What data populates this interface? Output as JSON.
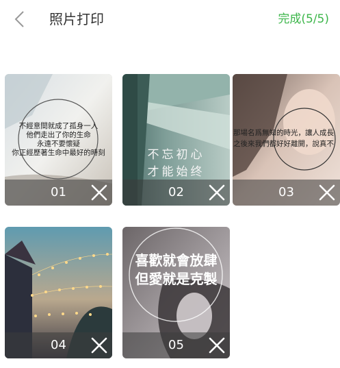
{
  "header": {
    "title": "照片打印",
    "done_label": "完成(5/5)"
  },
  "colors": {
    "accent": "#3cb64a",
    "title_text": "#333333",
    "overlay_bar": "rgba(60,60,60,0.55)"
  },
  "photos": [
    {
      "number": "01",
      "caption_lines": [
        "不經意間就成了孤身一人",
        "他們走出了你的生命",
        "永遠不要懷疑",
        "你正經歷著生命中最好的時刻"
      ]
    },
    {
      "number": "02",
      "caption_lines": [
        "不忘初心",
        "才能始终"
      ]
    },
    {
      "number": "03",
      "caption_lines": [
        "那場名爲無知的時光，讓人成長",
        "之後來我們都好好離開，說真不"
      ]
    },
    {
      "number": "04",
      "caption_lines": []
    },
    {
      "number": "05",
      "caption_lines": [
        "喜歡就會放肆",
        "但愛就是克製"
      ]
    }
  ],
  "icons": {
    "back": "chevron-left-icon",
    "delete": "close-icon"
  }
}
